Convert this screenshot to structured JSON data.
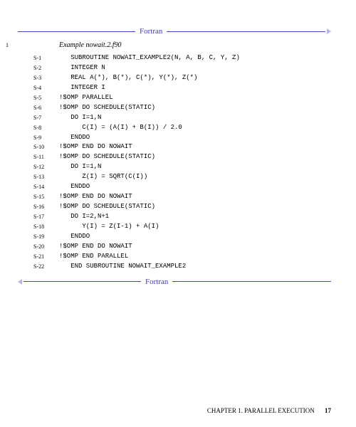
{
  "divider_label": "Fortran",
  "margin_line_num": "1",
  "example_title": "Example nowait.2.f90",
  "code_lines": [
    {
      "label": "S-1",
      "text": "   SUBROUTINE NOWAIT_EXAMPLE2(N, A, B, C, Y, Z)"
    },
    {
      "label": "S-2",
      "text": "   INTEGER N"
    },
    {
      "label": "S-3",
      "text": "   REAL A(*), B(*), C(*), Y(*), Z(*)"
    },
    {
      "label": "S-4",
      "text": "   INTEGER I"
    },
    {
      "label": "S-5",
      "text": "!$OMP PARALLEL"
    },
    {
      "label": "S-6",
      "text": "!$OMP DO SCHEDULE(STATIC)"
    },
    {
      "label": "S-7",
      "text": "   DO I=1,N"
    },
    {
      "label": "S-8",
      "text": "      C(I) = (A(I) + B(I)) / 2.0"
    },
    {
      "label": "S-9",
      "text": "   ENDDO"
    },
    {
      "label": "S-10",
      "text": "!$OMP END DO NOWAIT"
    },
    {
      "label": "S-11",
      "text": "!$OMP DO SCHEDULE(STATIC)"
    },
    {
      "label": "S-12",
      "text": "   DO I=1,N"
    },
    {
      "label": "S-13",
      "text": "      Z(I) = SQRT(C(I))"
    },
    {
      "label": "S-14",
      "text": "   ENDDO"
    },
    {
      "label": "S-15",
      "text": "!$OMP END DO NOWAIT"
    },
    {
      "label": "S-16",
      "text": "!$OMP DO SCHEDULE(STATIC)"
    },
    {
      "label": "S-17",
      "text": "   DO I=2,N+1"
    },
    {
      "label": "S-18",
      "text": "      Y(I) = Z(I-1) + A(I)"
    },
    {
      "label": "S-19",
      "text": "   ENDDO"
    },
    {
      "label": "S-20",
      "text": "!$OMP END DO NOWAIT"
    },
    {
      "label": "S-21",
      "text": "!$OMP END PARALLEL"
    },
    {
      "label": "S-22",
      "text": "   END SUBROUTINE NOWAIT_EXAMPLE2"
    }
  ],
  "footer_chapter": "CHAPTER 1.  PARALLEL EXECUTION",
  "footer_page": "17"
}
